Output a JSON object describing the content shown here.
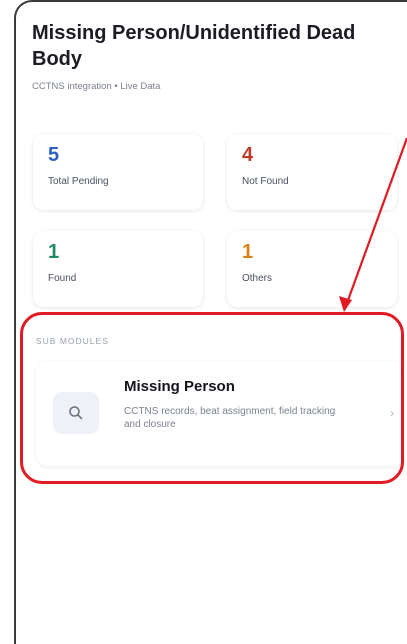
{
  "header": {
    "title": "Missing Person/Unidentified Dead Body",
    "subtitle": "CCTNS integration • Live Data"
  },
  "stats": [
    {
      "value": "5",
      "label": "Total Pending",
      "color": "#2f5fc4"
    },
    {
      "value": "4",
      "label": "Not Found",
      "color": "#c0392b"
    },
    {
      "value": "1",
      "label": "Found",
      "color": "#1e8a6a"
    },
    {
      "value": "1",
      "label": "Others",
      "color": "#d9821a"
    }
  ],
  "sub_modules": {
    "section_label": "SUB MODULES",
    "items": [
      {
        "title": "Missing Person",
        "description": "CCTNS records, beat assignment, field tracking and closure",
        "icon": "search-icon",
        "chevron": "›"
      }
    ]
  },
  "annotation": {
    "color": "#e01b24"
  }
}
